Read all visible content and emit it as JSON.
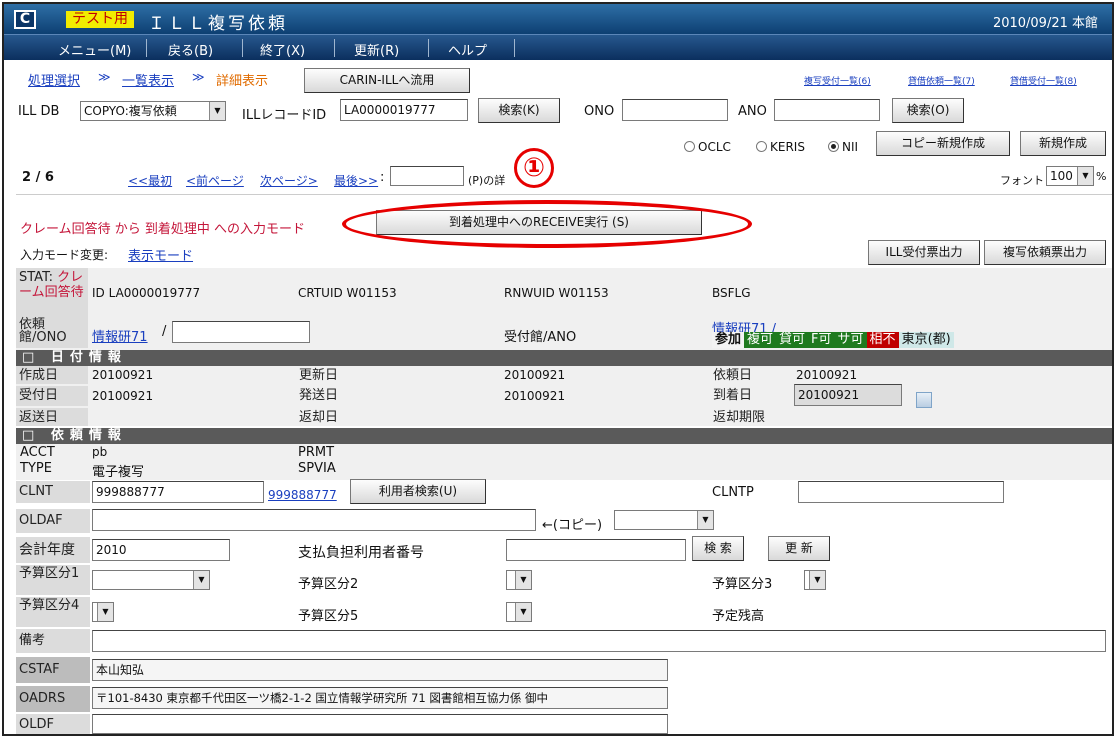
{
  "titlebar": {
    "test_tag": "テスト用",
    "title": "ＩＬＬ複写依頼",
    "date_library": "2010/09/21 本館"
  },
  "menu": {
    "menu": "メニュー(M)",
    "back": "戻る(B)",
    "exit": "終了(X)",
    "update": "更新(R)",
    "help": "ヘルプ"
  },
  "breadcrumb": {
    "select": "処理選択",
    "list": "一覧表示",
    "detail": "詳細表示",
    "sep": "≫"
  },
  "carin_button": "CARIN-ILLへ流用",
  "top_links": {
    "copy_recv_list": "複写受付一覧(6)",
    "loan_req_list": "貸借依頼一覧(7)",
    "loan_recv_list": "貸借受付一覧(8)"
  },
  "search": {
    "illdb_label": "ILL DB",
    "illdb_value": "COPYO:複写依頼",
    "record_label": "ILLレコードID",
    "record_value": "LA0000019777",
    "search_k": "検索(K)",
    "ono_label": "ONO",
    "ano_label": "ANO",
    "search_o": "検索(O)"
  },
  "radio": {
    "oclc": "OCLC",
    "keris": "KERIS",
    "nii": "NII"
  },
  "buttons": {
    "copy_new": "コピー新規作成",
    "new": "新規作成",
    "ill_recv_print": "ILL受付票出力",
    "copy_req_print": "複写依頼票出力",
    "receive": "到着処理中へのRECEIVE実行 (S)",
    "user_search": "利用者検索(U)",
    "search2": "検 索",
    "update2": "更 新"
  },
  "paging": {
    "counter": "2 / 6",
    "first": "<<最初",
    "prev": "<前ページ",
    "next": "次ページ>",
    "last": "最後>>",
    "colon": ":",
    "suffix": "(P)の詳",
    "font_label": "フォント",
    "font_value": "100",
    "percent": "%"
  },
  "mode": {
    "message": "クレーム回答待 から 到着処理中 への入力モード",
    "change_label": "入力モード変更:",
    "display_mode": "表示モード"
  },
  "annotation": {
    "number": "①"
  },
  "record": {
    "stat_label": "STAT:",
    "stat_value": "クレーム回答待",
    "id_label": "ID",
    "id_value": "LA0000019777",
    "crtuid": "CRTUID W01153",
    "rnwuid": "RNWUID W01153",
    "bsflg": "BSFLG",
    "req_lib_label": "依頼館/ONO",
    "req_lib_link": "情報研71",
    "slash": "/",
    "recv_lib_label": "受付館/ANO",
    "recv_lib_link": "情報研71 /",
    "tags": {
      "join": "参加",
      "copy": "複可",
      "loan": "貸可",
      "fax": "F可",
      "service": "サ可",
      "mutual": "相不",
      "region": "東京(都)"
    }
  },
  "date_section": {
    "title": "日付情報",
    "created_label": "作成日",
    "created": "20100921",
    "updated_label": "更新日",
    "updated": "20100921",
    "requested_label": "依頼日",
    "requested": "20100921",
    "received_label": "受付日",
    "received": "20100921",
    "sent_label": "発送日",
    "sent": "20100921",
    "arrived_label": "到着日",
    "arrived": "20100921",
    "returned_label": "返送日",
    "retback_label": "返却日",
    "due_label": "返却期限"
  },
  "req_section": {
    "title": "依頼情報",
    "acct_label": "ACCT",
    "acct": "pb",
    "prmt_label": "PRMT",
    "type_label": "TYPE",
    "type": "電子複写",
    "spvia_label": "SPVIA",
    "clnt_label": "CLNT",
    "clnt": "999888777",
    "clnt_link": "999888777",
    "clntp_label": "CLNTP",
    "oldaf_label": "OLDAF",
    "copy_label": "←(コピー)",
    "fiscal_label": "会計年度",
    "fiscal": "2010",
    "payer_label": "支払負担利用者番号",
    "budget1_label": "予算区分1",
    "budget2_label": "予算区分2",
    "budget3_label": "予算区分3",
    "budget4_label": "予算区分4",
    "budget5_label": "予算区分5",
    "balance_label": "予定残高",
    "note_label": "備考",
    "cstaf_label": "CSTAF",
    "cstaf": "本山知弘",
    "oadrs_label": "OADRS",
    "oadrs": "〒101-8430 東京都千代田区一ツ橋2-1-2 国立情報学研究所 71 図書館相互協力係 御中",
    "oldf_label": "OLDF"
  }
}
